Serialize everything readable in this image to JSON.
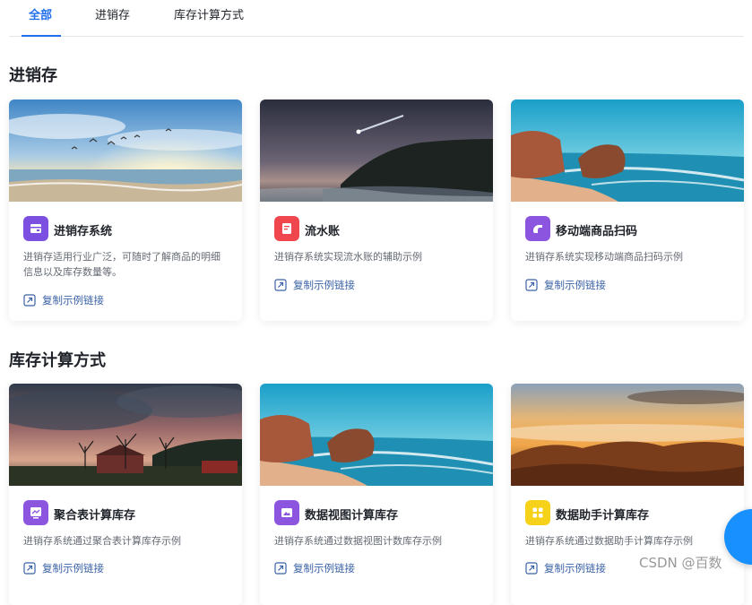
{
  "tabs": [
    {
      "label": "全部",
      "active": true
    },
    {
      "label": "进销存",
      "active": false
    },
    {
      "label": "库存计算方式",
      "active": false
    }
  ],
  "sections": [
    {
      "title": "进销存"
    },
    {
      "title": "库存计算方式"
    }
  ],
  "cards": [
    {
      "title": "进销存系统",
      "description": "进销存适用行业广泛，可随时了解商品的明细信息以及库存数量等。",
      "link": "复制示例链接",
      "icon": "inventory-app-icon",
      "icon_color": "#7b4fe0"
    },
    {
      "title": "流水账",
      "description": "进销存系统实现流水账的辅助示例",
      "link": "复制示例链接",
      "icon": "ledger-app-icon",
      "icon_color": "#f0464d"
    },
    {
      "title": "移动端商品扫码",
      "description": "进销存系统实现移动端商品扫码示例",
      "link": "复制示例链接",
      "icon": "scan-app-icon",
      "icon_color": "#8b55e0"
    },
    {
      "title": "聚合表计算库存",
      "description": "进销存系统通过聚合表计算库存示例",
      "link": "复制示例链接",
      "icon": "chart-app-icon",
      "icon_color": "#8b55e0"
    },
    {
      "title": "数据视图计算库存",
      "description": "进销存系统通过数据视图计数库存示例",
      "link": "复制示例链接",
      "icon": "image-app-icon",
      "icon_color": "#8b55e0"
    },
    {
      "title": "数据助手计算库存",
      "description": "进销存系统通过数据助手计算库存示例",
      "link": "复制示例链接",
      "icon": "grid-app-icon",
      "icon_color": "#f7d21b"
    }
  ],
  "watermark": "CSDN @百数",
  "colors": {
    "accent": "#1f6feb",
    "link": "#3b62a6",
    "fab": "#1890ff"
  }
}
